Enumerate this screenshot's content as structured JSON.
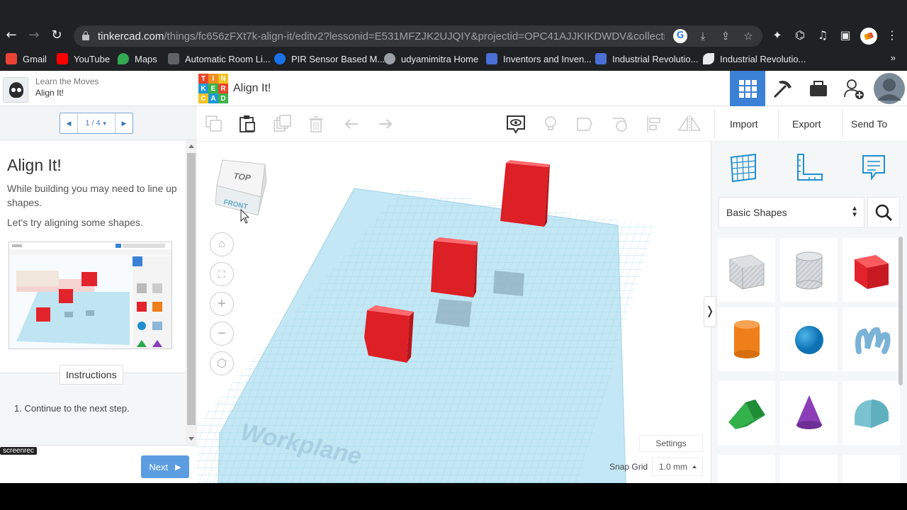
{
  "browser": {
    "url_host": "tinkercad.com",
    "url_path": "/things/fc656zFXt7k-align-it/editv2?lessonid=E531MFZJK2UJQIY&projectid=OPC41AJJKIKDWDV&collectionid=O...",
    "bookmarks": [
      {
        "label": "Gmail",
        "color": "#ea4335"
      },
      {
        "label": "YouTube",
        "color": "#ff0000"
      },
      {
        "label": "Maps",
        "color": "#34a853"
      },
      {
        "label": "Automatic Room Li...",
        "color": "#5f6368"
      },
      {
        "label": "PIR Sensor Based M...",
        "color": "#1a73e8"
      },
      {
        "label": "udyamimitra Home",
        "color": "#9aa0a6"
      },
      {
        "label": "Inventors and Inven...",
        "color": "#4a6fd6"
      },
      {
        "label": "Industrial Revolutio...",
        "color": "#4a6fd6"
      },
      {
        "label": "Industrial Revolutio...",
        "color": "#e8eaed"
      }
    ],
    "more_label": "»"
  },
  "lesson": {
    "subtitle": "Learn the Moves",
    "title": "Align It!",
    "pager": "1 / 4",
    "heading": "Align It!",
    "paragraph1": "While building you may need to line up shapes.",
    "paragraph2": "Let's try aligning some shapes.",
    "instructions_label": "Instructions",
    "step1": "1. Continue to the next step.",
    "next_label": "Next",
    "screenrec_label": "screenrec"
  },
  "editor": {
    "title": "Align It!",
    "logo_letters": [
      "T",
      "I",
      "N",
      "K",
      "E",
      "R",
      "C",
      "A",
      "D"
    ],
    "logo_colors": [
      "#e8462b",
      "#f28e1c",
      "#f6c122",
      "#1d9ad6",
      "#3cb44b",
      "#e8462b",
      "#f6c122",
      "#1d9ad6",
      "#3cb44b"
    ],
    "import_label": "Import",
    "export_label": "Export",
    "send_to_label": "Send To"
  },
  "viewcube": {
    "top_label": "TOP",
    "front_label": "FRONT"
  },
  "workplane": {
    "label": "Workplane",
    "settings_label": "Settings",
    "snap_label": "Snap Grid",
    "snap_value": "1.0 mm"
  },
  "shapes_panel": {
    "category": "Basic Shapes",
    "shapes": [
      "Box Hole",
      "Cylinder Hole",
      "Box",
      "Cylinder",
      "Sphere",
      "Scribble",
      "Roof",
      "Cone",
      "Round Roof"
    ]
  },
  "colors": {
    "accent": "#3b82d6",
    "box_red": "#e3232c",
    "workplane_blue": "#bfe5f3"
  }
}
